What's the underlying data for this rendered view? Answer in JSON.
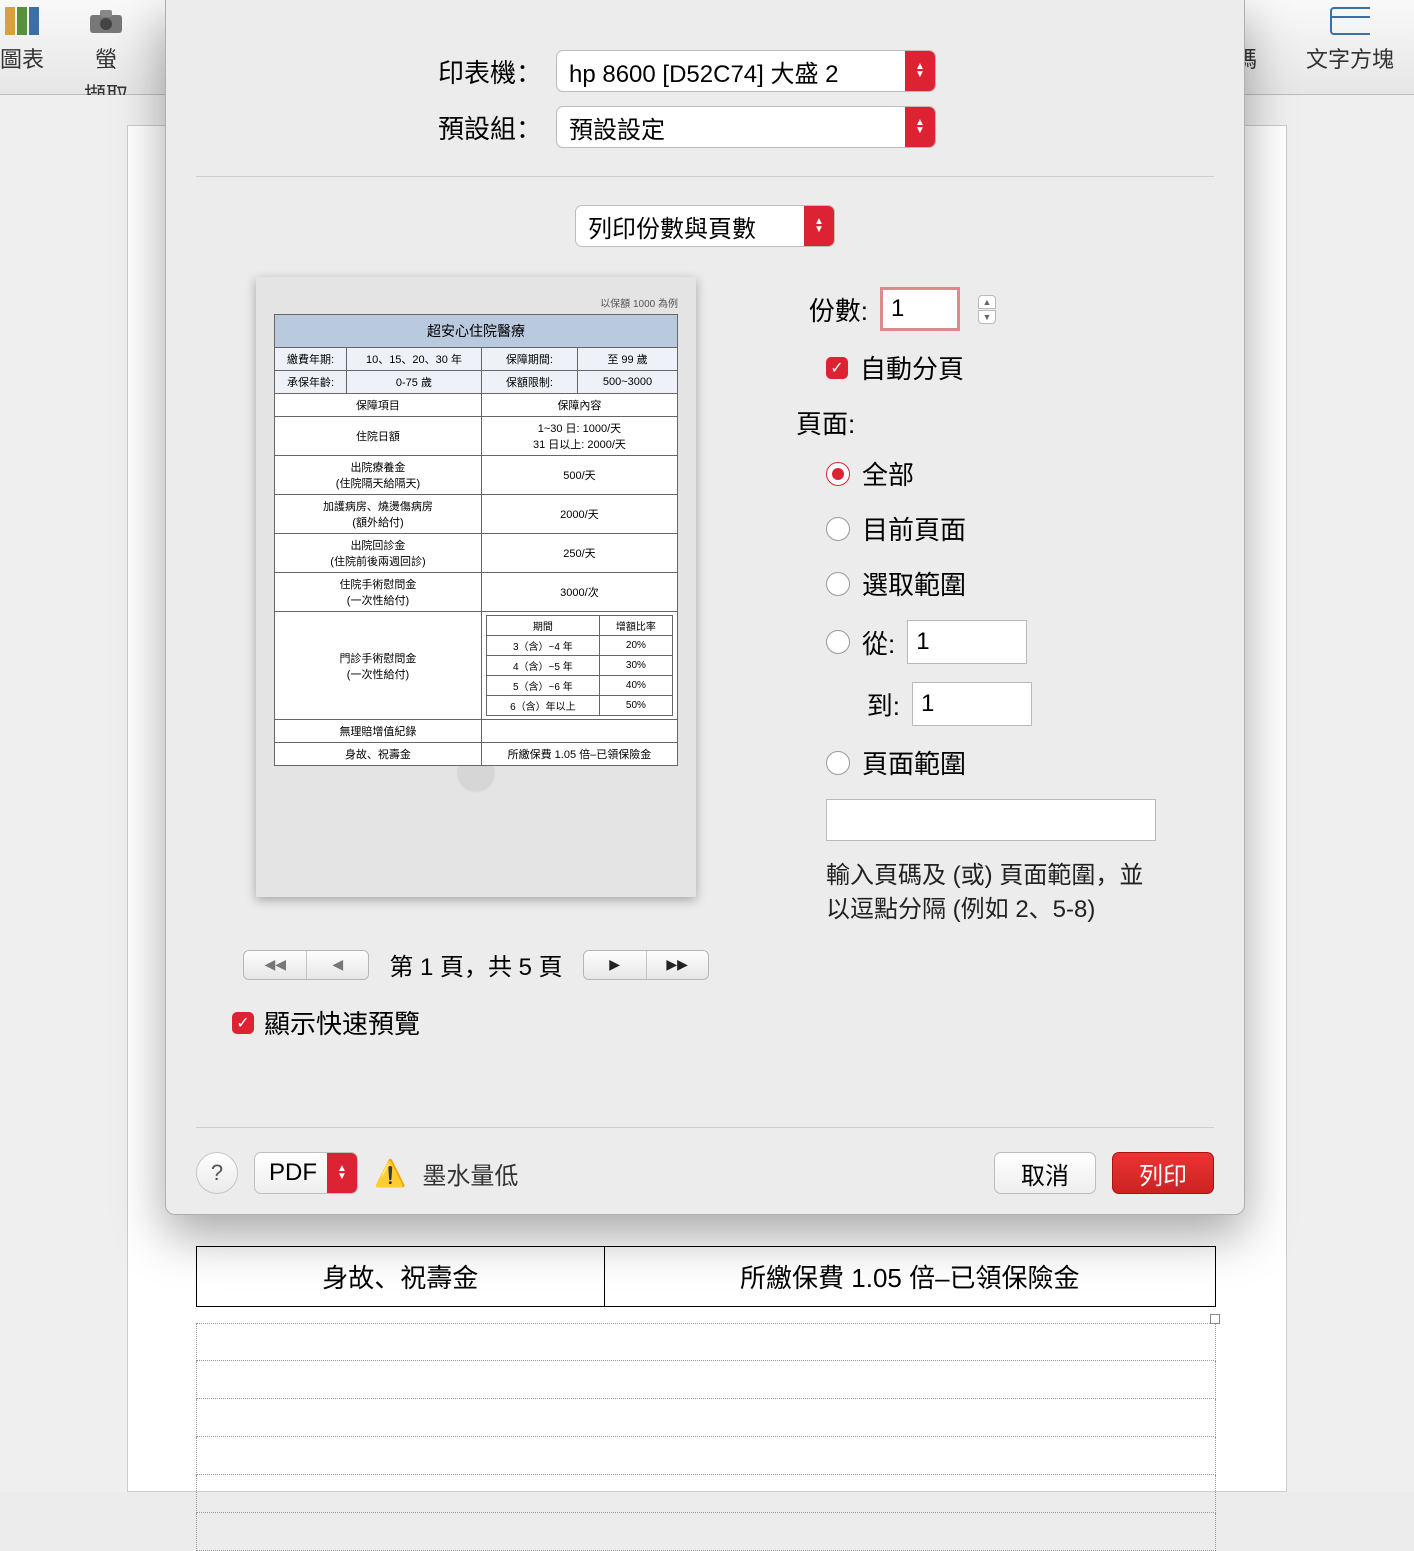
{
  "toolbar": {
    "left": [
      {
        "label": "圖表"
      },
      {
        "label": "螢",
        "sub": "擷取"
      }
    ],
    "right": [
      {
        "label": "碼"
      },
      {
        "label": "文字方塊"
      }
    ]
  },
  "dialog": {
    "printer_label": "印表機：",
    "printer_value": "hp 8600 [D52C74] 大盛 2",
    "preset_label": "預設組：",
    "preset_value": "預設設定",
    "section_value": "列印份數與頁數",
    "copies_label": "份數:",
    "copies_value": "1",
    "collate_label": "自動分頁",
    "pages_label": "頁面:",
    "radio_all": "全部",
    "radio_current": "目前頁面",
    "radio_selection": "選取範圍",
    "radio_from": "從:",
    "from_value": "1",
    "to_label": "到:",
    "to_value": "1",
    "radio_range": "頁面範圍",
    "range_hint": "輸入頁碼及 (或) 頁面範圍，並以逗點分隔 (例如 2、5-8)",
    "pager_text": "第 1 頁，共 5 頁",
    "quick_preview_label": "顯示快速預覽",
    "pdf_label": "PDF",
    "ink_low": "墨水量低",
    "cancel": "取消",
    "print": "列印",
    "help": "?"
  },
  "preview_doc": {
    "note": "以保額 1000 為例",
    "title": "超安心住院醫療",
    "meta": {
      "fee_years_k": "繳費年期:",
      "fee_years_v": "10、15、20、30 年",
      "cover_period_k": "保障期間:",
      "cover_period_v": "至 99 歲",
      "age_k": "承保年齡:",
      "age_v": "0-75 歲",
      "amount_limit_k": "保額限制:",
      "amount_limit_v": "500~3000"
    },
    "header_item": "保障項目",
    "header_content": "保障內容",
    "rows": [
      {
        "item": "住院日額",
        "content_l1": "1~30 日: 1000/天",
        "content_l2": "31 日以上: 2000/天"
      },
      {
        "item": "出院療養金",
        "sub": "(住院隔天給隔天)",
        "content": "500/天"
      },
      {
        "item": "加護病房、燒燙傷病房",
        "sub": "(額外給付)",
        "content": "2000/天"
      },
      {
        "item": "出院回診金",
        "sub": "(住院前後兩週回診)",
        "content": "250/天"
      },
      {
        "item": "住院手術慰問金",
        "sub": "(一次性給付)",
        "content": "3000/次"
      },
      {
        "item": "門診手術慰問金",
        "sub": "(一次性給付)",
        "content": ""
      }
    ],
    "bonus_label": "無理賠增值紀錄",
    "bonus_header_period": "期間",
    "bonus_header_rate": "增額比率",
    "bonus_rows": [
      {
        "p": "3（含）~4 年",
        "r": "20%"
      },
      {
        "p": "4（含）~5 年",
        "r": "30%"
      },
      {
        "p": "5（含）~6 年",
        "r": "40%"
      },
      {
        "p": "6（含）年以上",
        "r": "50%"
      }
    ],
    "death_k": "身故、祝壽金",
    "death_v": "所繳保費 1.05 倍–已領保險金"
  },
  "bg_doc": {
    "death_k": "身故、祝壽金",
    "death_v": "所繳保費 1.05 倍–已領保險金"
  }
}
